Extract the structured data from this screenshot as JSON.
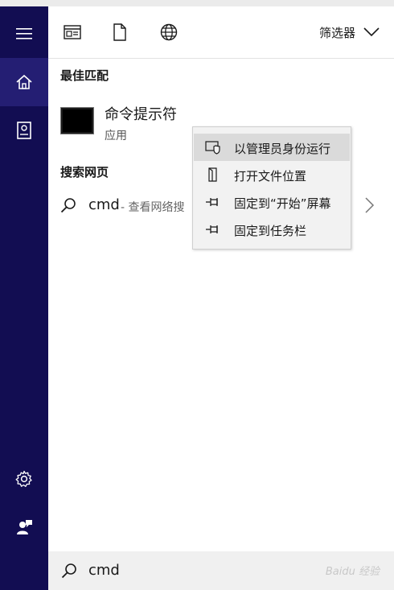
{
  "toolbar": {
    "filter_label": "筛选器",
    "icons": [
      "app-window-icon",
      "document-icon",
      "globe-icon",
      "chevron-down-icon"
    ]
  },
  "sidebar": {
    "items": [
      {
        "icon": "hamburger-menu-icon"
      },
      {
        "icon": "home-icon",
        "active": true
      },
      {
        "icon": "notebook-icon"
      },
      {
        "icon": "gear-icon"
      },
      {
        "icon": "feedback-icon"
      }
    ]
  },
  "best_match": {
    "section_title": "最佳匹配",
    "title": "命令提示符",
    "subtitle": "应用"
  },
  "web": {
    "section_title": "搜索网页",
    "query": "cmd",
    "description": "- 查看网络搜"
  },
  "context_menu": {
    "items": [
      {
        "label": "以管理员身份运行",
        "icon": "shield-icon",
        "highlighted": true
      },
      {
        "label": "打开文件位置",
        "icon": "file-location-icon"
      },
      {
        "label": "固定到“开始”屏幕",
        "icon": "pin-icon"
      },
      {
        "label": "固定到任务栏",
        "icon": "pin-icon"
      }
    ]
  },
  "search_box": {
    "value": "cmd"
  },
  "watermark": {
    "text": "Baidu 经验"
  },
  "colors": {
    "sidebar": "#120d52",
    "sidebar_active": "#241e73",
    "menu_bg": "#f2f2f2",
    "menu_hover": "#dadada",
    "search_bg": "#f0f0f0"
  }
}
